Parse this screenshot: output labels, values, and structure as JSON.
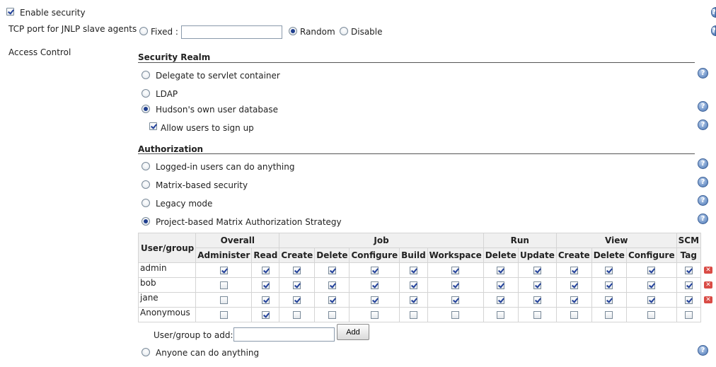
{
  "enable_security": {
    "label": "Enable security",
    "checked": true
  },
  "jnlp": {
    "label": "TCP port for JNLP slave agents",
    "options": [
      {
        "label": "Fixed :",
        "selected": false
      },
      {
        "label": "Random",
        "selected": true
      },
      {
        "label": "Disable",
        "selected": false
      }
    ],
    "fixed_value": ""
  },
  "access_control_label": "Access Control",
  "security_realm": {
    "title": "Security Realm",
    "options": [
      {
        "label": "Delegate to servlet container",
        "selected": false
      },
      {
        "label": "LDAP",
        "selected": false
      },
      {
        "label": "Hudson's own user database",
        "selected": true
      }
    ],
    "allow_signup": {
      "label": "Allow users to sign up",
      "checked": true
    }
  },
  "authorization": {
    "title": "Authorization",
    "options": [
      {
        "label": "Logged-in users can do anything",
        "selected": false
      },
      {
        "label": "Matrix-based security",
        "selected": false
      },
      {
        "label": "Legacy mode",
        "selected": false
      },
      {
        "label": "Project-based Matrix Authorization Strategy",
        "selected": true
      },
      {
        "label": "Anyone can do anything",
        "selected": false
      }
    ]
  },
  "matrix": {
    "user_header": "User/group",
    "groups": [
      {
        "name": "Overall",
        "span": 2
      },
      {
        "name": "Job",
        "span": 5
      },
      {
        "name": "Run",
        "span": 2
      },
      {
        "name": "View",
        "span": 3
      },
      {
        "name": "SCM",
        "span": 1
      }
    ],
    "permissions": [
      "Administer",
      "Read",
      "Create",
      "Delete",
      "Configure",
      "Build",
      "Workspace",
      "Delete",
      "Update",
      "Create",
      "Delete",
      "Configure",
      "Tag"
    ],
    "rows": [
      {
        "user": "admin",
        "perms": [
          true,
          true,
          true,
          true,
          true,
          true,
          true,
          true,
          true,
          true,
          true,
          true,
          true
        ],
        "removable": true
      },
      {
        "user": "bob",
        "perms": [
          false,
          true,
          true,
          true,
          true,
          true,
          true,
          true,
          true,
          true,
          true,
          true,
          true
        ],
        "removable": true
      },
      {
        "user": "jane",
        "perms": [
          false,
          true,
          true,
          true,
          true,
          true,
          true,
          true,
          true,
          true,
          true,
          true,
          true
        ],
        "removable": true
      },
      {
        "user": "Anonymous",
        "perms": [
          false,
          true,
          false,
          false,
          false,
          false,
          false,
          false,
          false,
          false,
          false,
          false,
          false
        ],
        "removable": false
      }
    ]
  },
  "add_user": {
    "label": "User/group to add:",
    "value": "",
    "button": "Add"
  },
  "help_icon_glyph": "?",
  "remove_icon_glyph": "✕"
}
